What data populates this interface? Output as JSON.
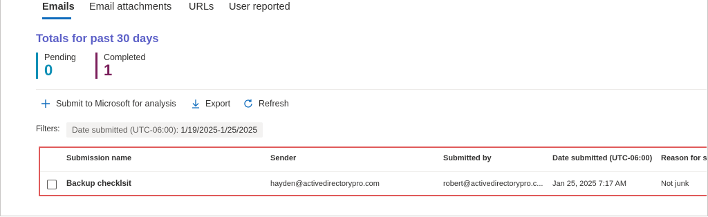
{
  "tabs": [
    {
      "label": "Emails",
      "active": true
    },
    {
      "label": "Email attachments",
      "active": false
    },
    {
      "label": "URLs",
      "active": false
    },
    {
      "label": "User reported",
      "active": false
    }
  ],
  "totals": {
    "title": "Totals for past 30 days",
    "pending": {
      "label": "Pending",
      "value": "0"
    },
    "completed": {
      "label": "Completed",
      "value": "1"
    }
  },
  "commands": {
    "submit": "Submit to Microsoft for analysis",
    "export": "Export",
    "refresh": "Refresh"
  },
  "filters": {
    "label": "Filters:",
    "chip_key": "Date submitted (UTC-06:00):",
    "chip_value": "1/19/2025-1/25/2025"
  },
  "table": {
    "headers": {
      "name": "Submission name",
      "sender": "Sender",
      "submitted_by": "Submitted by",
      "date": "Date submitted (UTC-06:00)",
      "reason": "Reason for su"
    },
    "rows": [
      {
        "name": "Backup checklsit",
        "sender": "hayden@activedirectorypro.com",
        "submitted_by": "robert@activedirectorypro.c...",
        "date": "Jan 25, 2025 7:17 AM",
        "reason": "Not junk"
      }
    ]
  },
  "colors": {
    "accent": "#0f6cbd",
    "totals_title": "#5b5fc7",
    "pending": "#0e8fb5",
    "completed": "#7a1e5a",
    "highlight_box": "#e05a5a"
  }
}
